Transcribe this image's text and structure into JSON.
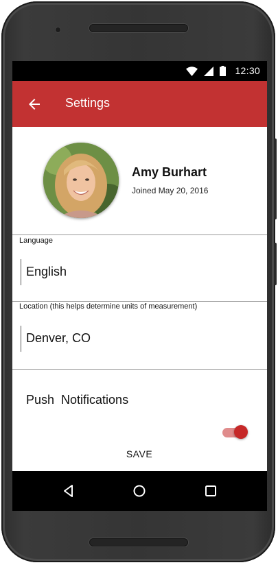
{
  "status_bar": {
    "time": "12:30",
    "icons": [
      "wifi-icon",
      "cellular-signal-icon",
      "battery-icon"
    ]
  },
  "app_bar": {
    "title": "Settings",
    "back_icon": "arrow-left-icon",
    "color": "#c23232"
  },
  "profile": {
    "name": "Amy Burhart",
    "joined": "Joined May 20, 2016"
  },
  "language": {
    "label": "Language",
    "value": "English"
  },
  "location": {
    "label": "Location (this helps determine units of measurement)",
    "value": "Denver, CO"
  },
  "push": {
    "label": "Push  Notifications",
    "enabled": true,
    "accent": "#c62828"
  },
  "save_label": "SAVE",
  "nav": {
    "icons": [
      "back-triangle-icon",
      "home-circle-icon",
      "recents-square-icon"
    ]
  }
}
